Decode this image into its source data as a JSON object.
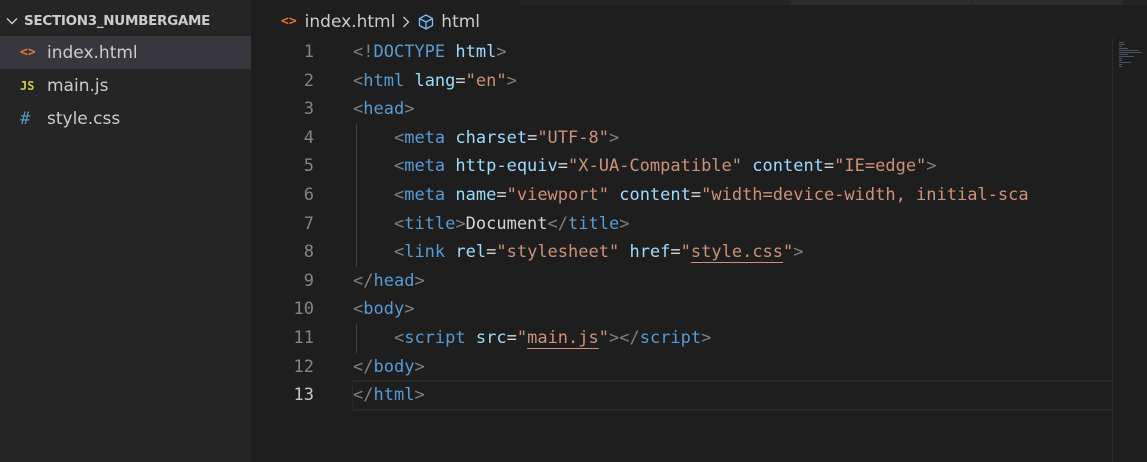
{
  "explorer": {
    "folder_name": "SECTION3_NUMBERGAME",
    "files": [
      {
        "name": "index.html",
        "icon": "html-file-icon",
        "icon_glyph": "<>",
        "active": true
      },
      {
        "name": "main.js",
        "icon": "js-file-icon",
        "icon_glyph": "JS",
        "active": false
      },
      {
        "name": "style.css",
        "icon": "css-file-icon",
        "icon_glyph": "#",
        "active": false
      }
    ]
  },
  "breadcrumb": {
    "file_icon_glyph": "<>",
    "file": "index.html",
    "separator": ">",
    "symbol": "html"
  },
  "editor": {
    "current_line": 13,
    "lines": [
      {
        "n": "1",
        "tokens": [
          [
            "p",
            "<!"
          ],
          [
            "t",
            "DOCTYPE"
          ],
          [
            "x",
            " "
          ],
          [
            "a",
            "html"
          ],
          [
            "p",
            ">"
          ]
        ]
      },
      {
        "n": "2",
        "tokens": [
          [
            "p",
            "<"
          ],
          [
            "t",
            "html"
          ],
          [
            "x",
            " "
          ],
          [
            "a",
            "lang"
          ],
          [
            "x",
            "="
          ],
          [
            "s",
            "\"en\""
          ],
          [
            "p",
            ">"
          ]
        ]
      },
      {
        "n": "3",
        "tokens": [
          [
            "p",
            "<"
          ],
          [
            "t",
            "head"
          ],
          [
            "p",
            ">"
          ]
        ]
      },
      {
        "n": "4",
        "tokens": [
          [
            "x",
            "    "
          ],
          [
            "p",
            "<"
          ],
          [
            "t",
            "meta"
          ],
          [
            "x",
            " "
          ],
          [
            "a",
            "charset"
          ],
          [
            "x",
            "="
          ],
          [
            "s",
            "\"UTF-8\""
          ],
          [
            "p",
            ">"
          ]
        ]
      },
      {
        "n": "5",
        "tokens": [
          [
            "x",
            "    "
          ],
          [
            "p",
            "<"
          ],
          [
            "t",
            "meta"
          ],
          [
            "x",
            " "
          ],
          [
            "a",
            "http-equiv"
          ],
          [
            "x",
            "="
          ],
          [
            "s",
            "\"X-UA-Compatible\""
          ],
          [
            "x",
            " "
          ],
          [
            "a",
            "content"
          ],
          [
            "x",
            "="
          ],
          [
            "s",
            "\"IE=edge\""
          ],
          [
            "p",
            ">"
          ]
        ]
      },
      {
        "n": "6",
        "tokens": [
          [
            "x",
            "    "
          ],
          [
            "p",
            "<"
          ],
          [
            "t",
            "meta"
          ],
          [
            "x",
            " "
          ],
          [
            "a",
            "name"
          ],
          [
            "x",
            "="
          ],
          [
            "s",
            "\"viewport\""
          ],
          [
            "x",
            " "
          ],
          [
            "a",
            "content"
          ],
          [
            "x",
            "="
          ],
          [
            "s",
            "\"width=device-width, initial-sca"
          ]
        ]
      },
      {
        "n": "7",
        "tokens": [
          [
            "x",
            "    "
          ],
          [
            "p",
            "<"
          ],
          [
            "t",
            "title"
          ],
          [
            "p",
            ">"
          ],
          [
            "x",
            "Document"
          ],
          [
            "p",
            "</"
          ],
          [
            "t",
            "title"
          ],
          [
            "p",
            ">"
          ]
        ]
      },
      {
        "n": "8",
        "tokens": [
          [
            "x",
            "    "
          ],
          [
            "p",
            "<"
          ],
          [
            "t",
            "link"
          ],
          [
            "x",
            " "
          ],
          [
            "a",
            "rel"
          ],
          [
            "x",
            "="
          ],
          [
            "s",
            "\"stylesheet\""
          ],
          [
            "x",
            " "
          ],
          [
            "a",
            "href"
          ],
          [
            "x",
            "="
          ],
          [
            "s",
            "\""
          ],
          [
            "u",
            "style.css"
          ],
          [
            "s",
            "\""
          ],
          [
            "p",
            ">"
          ]
        ]
      },
      {
        "n": "9",
        "tokens": [
          [
            "p",
            "</"
          ],
          [
            "t",
            "head"
          ],
          [
            "p",
            ">"
          ]
        ]
      },
      {
        "n": "10",
        "tokens": [
          [
            "p",
            "<"
          ],
          [
            "t",
            "body"
          ],
          [
            "p",
            ">"
          ]
        ]
      },
      {
        "n": "11",
        "tokens": [
          [
            "x",
            "    "
          ],
          [
            "p",
            "<"
          ],
          [
            "t",
            "script"
          ],
          [
            "x",
            " "
          ],
          [
            "a",
            "src"
          ],
          [
            "x",
            "="
          ],
          [
            "s",
            "\""
          ],
          [
            "u",
            "main.js"
          ],
          [
            "s",
            "\""
          ],
          [
            "p",
            "></"
          ],
          [
            "t",
            "script"
          ],
          [
            "p",
            ">"
          ]
        ]
      },
      {
        "n": "12",
        "tokens": [
          [
            "p",
            "</"
          ],
          [
            "t",
            "body"
          ],
          [
            "p",
            ">"
          ]
        ]
      },
      {
        "n": "13",
        "tokens": [
          [
            "p",
            "</"
          ],
          [
            "t",
            "html"
          ],
          [
            "p",
            ">"
          ]
        ]
      }
    ]
  },
  "colors": {
    "punctuation": "#808080",
    "tag": "#569cd6",
    "attribute": "#9cdcfe",
    "string": "#ce9178",
    "text": "#d4d4d4",
    "html_icon": "#e37933",
    "js_icon": "#cbcb41",
    "css_icon": "#519aba",
    "editor_bg": "#1e1e1e",
    "sidebar_bg": "#252526"
  }
}
